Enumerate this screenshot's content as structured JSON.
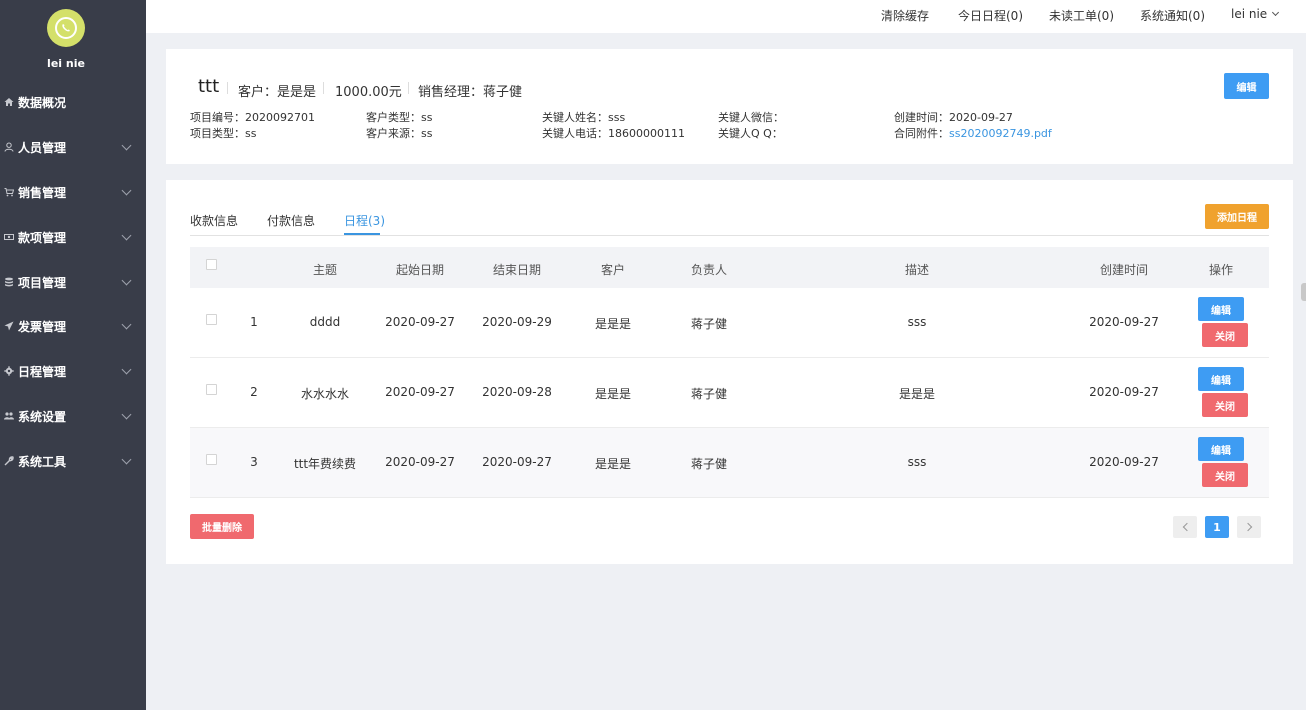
{
  "user": {
    "name": "lei nie"
  },
  "sidebar": {
    "items": [
      {
        "label": "数据概况",
        "icon": "home-icon",
        "has_children": false
      },
      {
        "label": "人员管理",
        "icon": "user-icon",
        "has_children": true
      },
      {
        "label": "销售管理",
        "icon": "cart-icon",
        "has_children": true
      },
      {
        "label": "款项管理",
        "icon": "money-icon",
        "has_children": true
      },
      {
        "label": "项目管理",
        "icon": "database-icon",
        "has_children": true
      },
      {
        "label": "发票管理",
        "icon": "send-icon",
        "has_children": true
      },
      {
        "label": "日程管理",
        "icon": "gear-icon",
        "has_children": true
      },
      {
        "label": "系统设置",
        "icon": "users-icon",
        "has_children": true
      },
      {
        "label": "系统工具",
        "icon": "wrench-icon",
        "has_children": true
      }
    ]
  },
  "topbar": {
    "clear_cache": "清除缓存",
    "today_schedule": "今日日程(0)",
    "unread_tickets": "未读工单(0)",
    "notifications": "系统通知(0)",
    "user_menu": "lei nie"
  },
  "project": {
    "title": "ttt",
    "customer": "客户：是是是",
    "amount": "1000.00元",
    "sales_manager": "销售经理：蒋子健",
    "edit_label": "编辑",
    "fields": {
      "project_no_label": "项目编号：",
      "project_no": "2020092701",
      "project_type_label": "项目类型：",
      "project_type": "ss",
      "customer_type_label": "客户类型：",
      "customer_type": "ss",
      "customer_source_label": "客户来源：",
      "customer_source": "ss",
      "contact_name_label": "关键人姓名：",
      "contact_name": "sss",
      "contact_phone_label": "关键人电话：",
      "contact_phone": "18600000111",
      "contact_wechat_label": "关键人微信：",
      "contact_wechat": "",
      "contact_qq_label": "关键人Q Q：",
      "contact_qq": "",
      "created_label": "创建时间：",
      "created": "2020-09-27",
      "attachment_label": "合同附件：",
      "attachment": "ss2020092749.pdf"
    }
  },
  "tabs": [
    {
      "label": "收款信息",
      "active": false
    },
    {
      "label": "付款信息",
      "active": false
    },
    {
      "label": "日程(3)",
      "active": true
    }
  ],
  "add_schedule_label": "添加日程",
  "table": {
    "headers": [
      "主题",
      "起始日期",
      "结束日期",
      "客户",
      "负责人",
      "描述",
      "创建时间",
      "操作"
    ],
    "rows": [
      {
        "no": "1",
        "subject": "dddd",
        "start": "2020-09-27",
        "end": "2020-09-29",
        "customer": "是是是",
        "owner": "蒋子健",
        "desc": "sss",
        "created": "2020-09-27"
      },
      {
        "no": "2",
        "subject": "水水水水",
        "start": "2020-09-27",
        "end": "2020-09-28",
        "customer": "是是是",
        "owner": "蒋子健",
        "desc": "是是是",
        "created": "2020-09-27"
      },
      {
        "no": "3",
        "subject": "ttt年费续费",
        "start": "2020-09-27",
        "end": "2020-09-27",
        "customer": "是是是",
        "owner": "蒋子健",
        "desc": "sss",
        "created": "2020-09-27"
      }
    ],
    "edit_label": "编辑",
    "close_label": "关闭"
  },
  "batch_delete_label": "批量删除",
  "pagination": {
    "current": "1"
  },
  "colors": {
    "sidebar_bg": "#393d49",
    "primary": "#3e9cf3",
    "danger": "#f0696e",
    "warning": "#f0a22e",
    "avatar": "#d4e06a"
  }
}
